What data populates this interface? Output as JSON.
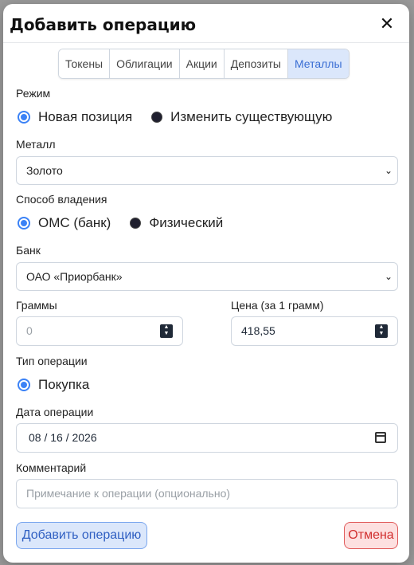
{
  "modal": {
    "title": "Добавить операцию",
    "close": "✕"
  },
  "tabs": [
    {
      "label": "Токены",
      "active": false
    },
    {
      "label": "Облигации",
      "active": false
    },
    {
      "label": "Акции",
      "active": false
    },
    {
      "label": "Депозиты",
      "active": false
    },
    {
      "label": "Металлы",
      "active": true
    }
  ],
  "mode": {
    "label": "Режим",
    "options": [
      "Новая позиция",
      "Изменить существующую"
    ],
    "selected": "Новая позиция"
  },
  "metal": {
    "label": "Металл",
    "value": "Золото"
  },
  "ownership": {
    "label": "Способ владения",
    "options": [
      "ОМС (банк)",
      "Физический"
    ],
    "selected": "ОМС (банк)"
  },
  "bank": {
    "label": "Банк",
    "value": "ОАО «Приорбанк»"
  },
  "grams": {
    "label": "Граммы",
    "placeholder": "0"
  },
  "price": {
    "label": "Цена (за 1 грамм)",
    "value": "418,55"
  },
  "op_type": {
    "label": "Тип операции",
    "options": [
      "Покупка"
    ],
    "selected": "Покупка"
  },
  "date": {
    "label": "Дата операции",
    "value": "08 / 16 / 2026"
  },
  "comment": {
    "label": "Комментарий",
    "placeholder": "Примечание к операции (опционально)"
  },
  "actions": {
    "submit": "Добавить операцию",
    "cancel": "Отмена"
  },
  "colors": {
    "accent": "#3b82f6",
    "active_tab_bg": "#dbe7fb",
    "cancel": "#d12f2f"
  }
}
